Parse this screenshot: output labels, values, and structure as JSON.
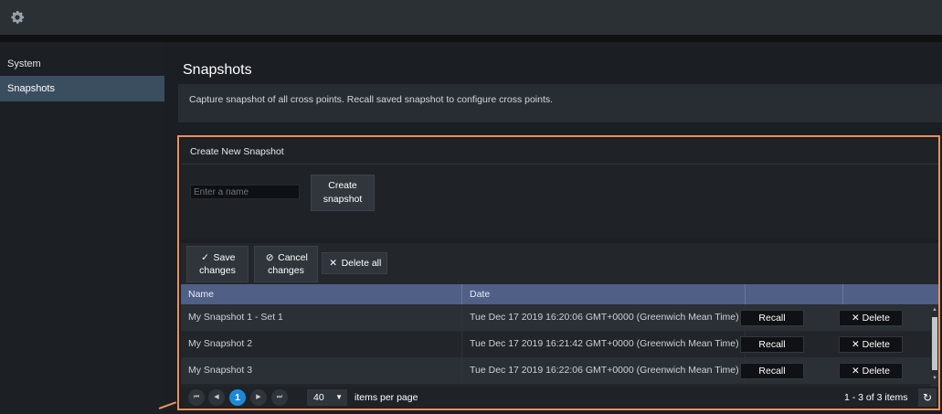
{
  "header": {
    "icon": "gear-icon"
  },
  "sidebar": {
    "items": [
      {
        "label": "System"
      },
      {
        "label": "Snapshots"
      }
    ]
  },
  "page": {
    "title": "Snapshots",
    "description": "Capture snapshot of all cross points. Recall saved snapshot to configure cross points."
  },
  "create_panel": {
    "heading": "Create New Snapshot",
    "name_placeholder": "Enter a name",
    "create_line1": "Create",
    "create_line2": "snapshot"
  },
  "toolbar": {
    "save_line1": "Save",
    "save_line2": "changes",
    "cancel_line1": "Cancel",
    "cancel_line2": "changes",
    "delete_all": "Delete all"
  },
  "grid": {
    "columns": [
      "Name",
      "Date",
      "",
      ""
    ],
    "recall_label": "Recall",
    "delete_label": "Delete",
    "rows": [
      {
        "name": "My Snapshot 1 - Set 1",
        "date": "Tue Dec 17 2019 16:20:06 GMT+0000 (Greenwich Mean Time)"
      },
      {
        "name": "My Snapshot 2",
        "date": "Tue Dec 17 2019 16:21:42 GMT+0000 (Greenwich Mean Time)"
      },
      {
        "name": "My Snapshot 3",
        "date": "Tue Dec 17 2019 16:22:06 GMT+0000 (Greenwich Mean Time)"
      }
    ]
  },
  "pager": {
    "current_page": "1",
    "page_size": "40",
    "page_size_label": "items per page",
    "range": "1 - 3 of 3 items"
  },
  "colors": {
    "accent_frame": "#e8915d",
    "grid_header": "#4f5f85",
    "current_page": "#1e88d6",
    "active_nav": "#3a4e60"
  }
}
